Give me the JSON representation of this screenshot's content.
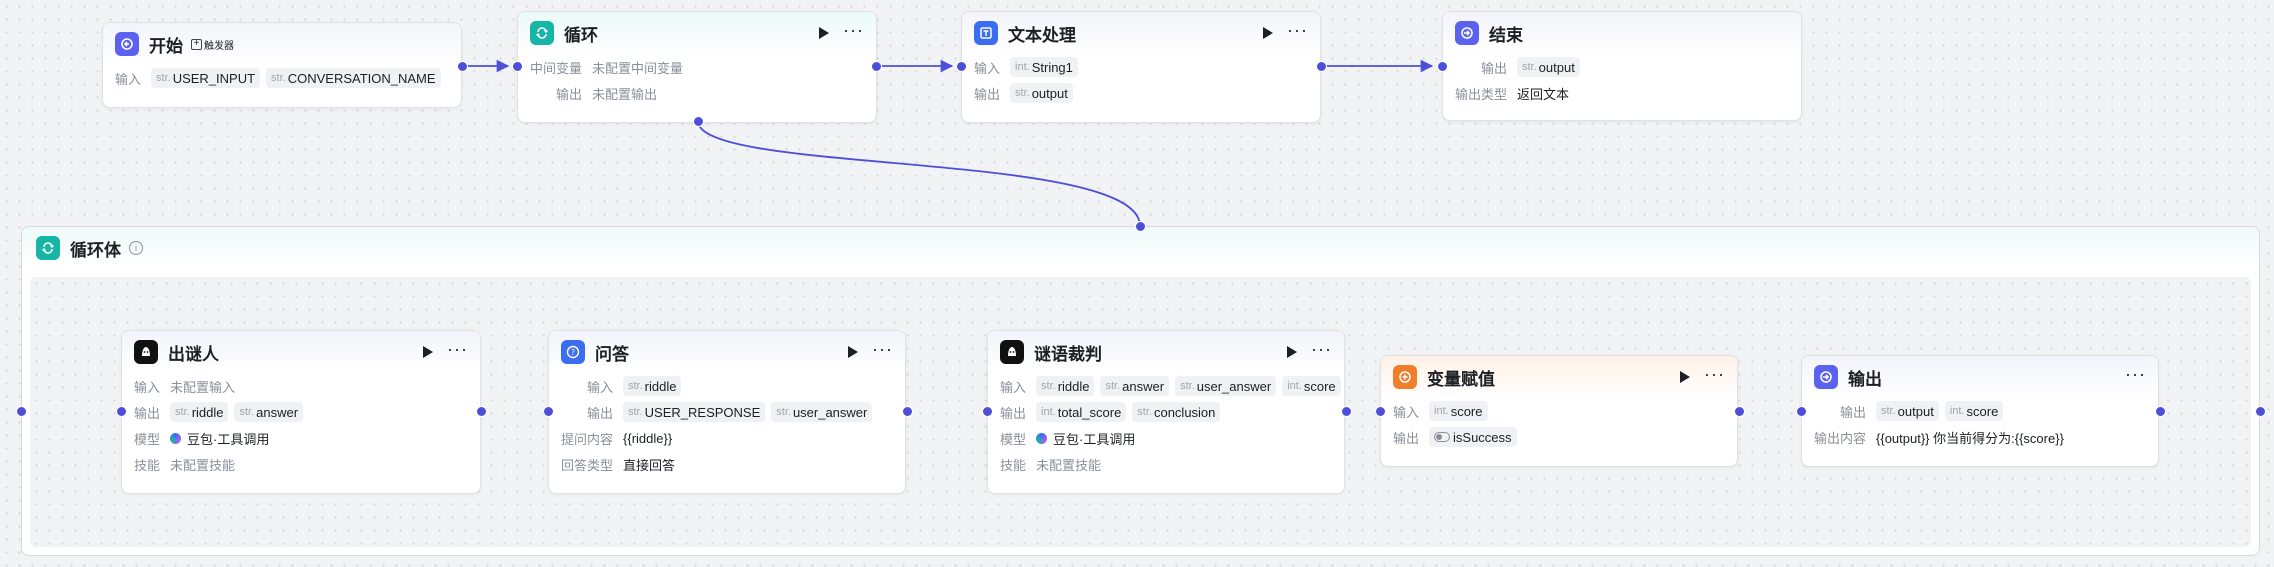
{
  "colors": {
    "edge": "#4e4fd9",
    "start": "#5c62f0",
    "loop": "#17b5a6",
    "text_proc": "#3b6df2",
    "qa": "#3b6df2",
    "assign": "#f07d2a"
  },
  "nodes": {
    "start": {
      "title": "开始",
      "trigger_label": "触发器",
      "input_label": "输入",
      "inputs": [
        {
          "type": "str.",
          "name": "USER_INPUT"
        },
        {
          "type": "str.",
          "name": "CONVERSATION_NAME"
        }
      ]
    },
    "loop": {
      "title": "循环",
      "intermediate_label": "中间变量",
      "intermediate_value": "未配置中间变量",
      "output_label": "输出",
      "output_value": "未配置输出"
    },
    "text_processing": {
      "title": "文本处理",
      "input_label": "输入",
      "input_type": "int.",
      "input_name": "String1",
      "output_label": "输出",
      "output_type": "str.",
      "output_name": "output"
    },
    "end": {
      "title": "结束",
      "output_label": "输出",
      "output_type": "str.",
      "output_name": "output",
      "output_type_label": "输出类型",
      "output_type_value": "返回文本"
    },
    "loop_body": {
      "title": "循环体"
    },
    "riddler": {
      "title": "出谜人",
      "input_label": "输入",
      "input_value": "未配置输入",
      "output_label": "输出",
      "outputs": [
        {
          "type": "str.",
          "name": "riddle"
        },
        {
          "type": "str.",
          "name": "answer"
        }
      ],
      "model_label": "模型",
      "model_value": "豆包·工具调用",
      "skill_label": "技能",
      "skill_value": "未配置技能"
    },
    "qa": {
      "title": "问答",
      "input_label": "输入",
      "input_type": "str.",
      "input_name": "riddle",
      "output_label": "输出",
      "outputs": [
        {
          "type": "str.",
          "name": "USER_RESPONSE"
        },
        {
          "type": "str.",
          "name": "user_answer"
        }
      ],
      "question_label": "提问内容",
      "question_value": "{{riddle}}",
      "answer_type_label": "回答类型",
      "answer_type_value": "直接回答"
    },
    "judge": {
      "title": "谜语裁判",
      "input_label": "输入",
      "inputs": [
        {
          "type": "str.",
          "name": "riddle"
        },
        {
          "type": "str.",
          "name": "answer"
        },
        {
          "type": "str.",
          "name": "user_answer"
        },
        {
          "type": "int.",
          "name": "score"
        }
      ],
      "output_label": "输出",
      "outputs": [
        {
          "type": "int.",
          "name": "total_score"
        },
        {
          "type": "str.",
          "name": "conclusion"
        }
      ],
      "model_label": "模型",
      "model_value": "豆包·工具调用",
      "skill_label": "技能",
      "skill_value": "未配置技能"
    },
    "assign": {
      "title": "变量赋值",
      "input_label": "输入",
      "input_type": "int.",
      "input_name": "score",
      "output_label": "输出",
      "output_name": "isSuccess"
    },
    "output": {
      "title": "输出",
      "output_label": "输出",
      "outputs": [
        {
          "type": "str.",
          "name": "output"
        },
        {
          "type": "int.",
          "name": "score"
        }
      ],
      "content_label": "输出内容",
      "content_value": "{{output}} 你当前得分为:{{score}}"
    }
  }
}
